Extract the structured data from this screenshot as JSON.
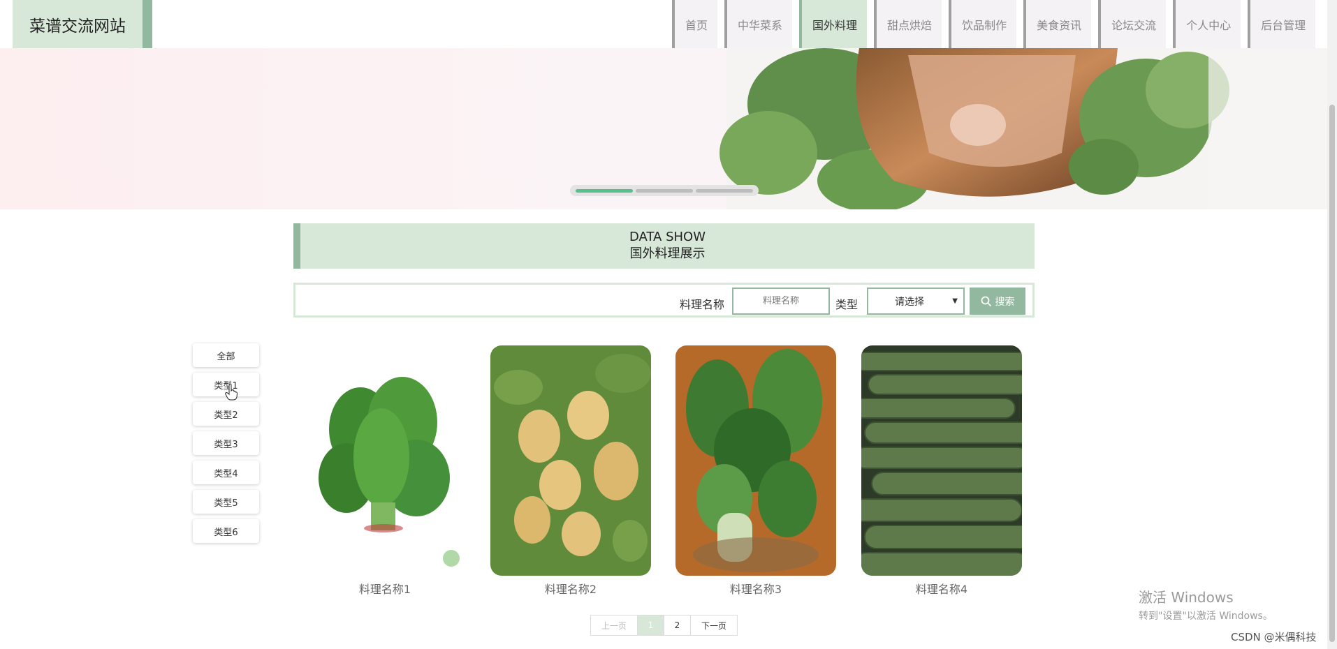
{
  "header": {
    "site_title": "菜谱交流网站",
    "nav": [
      {
        "label": "首页",
        "active": false
      },
      {
        "label": "中华菜系",
        "active": false
      },
      {
        "label": "国外料理",
        "active": true
      },
      {
        "label": "甜点烘焙",
        "active": false
      },
      {
        "label": "饮品制作",
        "active": false
      },
      {
        "label": "美食资讯",
        "active": false
      },
      {
        "label": "论坛交流",
        "active": false
      },
      {
        "label": "个人中心",
        "active": false
      },
      {
        "label": "后台管理",
        "active": false
      }
    ]
  },
  "banner": {
    "slide_count": 3,
    "active_slide": 1
  },
  "section": {
    "title_en": "DATA SHOW",
    "title_cn": "国外料理展示"
  },
  "search": {
    "name_label": "料理名称",
    "name_placeholder": "料理名称",
    "type_label": "类型",
    "type_selected": "请选择",
    "button_label": "搜索"
  },
  "categories": [
    "全部",
    "类型1",
    "类型2",
    "类型3",
    "类型4",
    "类型5",
    "类型6"
  ],
  "items": [
    {
      "name": "料理名称1",
      "image": "spinach"
    },
    {
      "name": "料理名称2",
      "image": "potatoes"
    },
    {
      "name": "料理名称3",
      "image": "leafy-greens"
    },
    {
      "name": "料理名称4",
      "image": "cucumbers"
    }
  ],
  "pagination": {
    "prev": "上一页",
    "pages": [
      "1",
      "2"
    ],
    "current": "1",
    "next": "下一页"
  },
  "watermark": {
    "line1": "激活 Windows",
    "line2": "转到\"设置\"以激活 Windows。"
  },
  "credit": "CSDN @米偶科技",
  "colors": {
    "accent": "#92b9a0",
    "accent_light": "#d8e8d8",
    "nav_bg": "#f4f2f4"
  }
}
